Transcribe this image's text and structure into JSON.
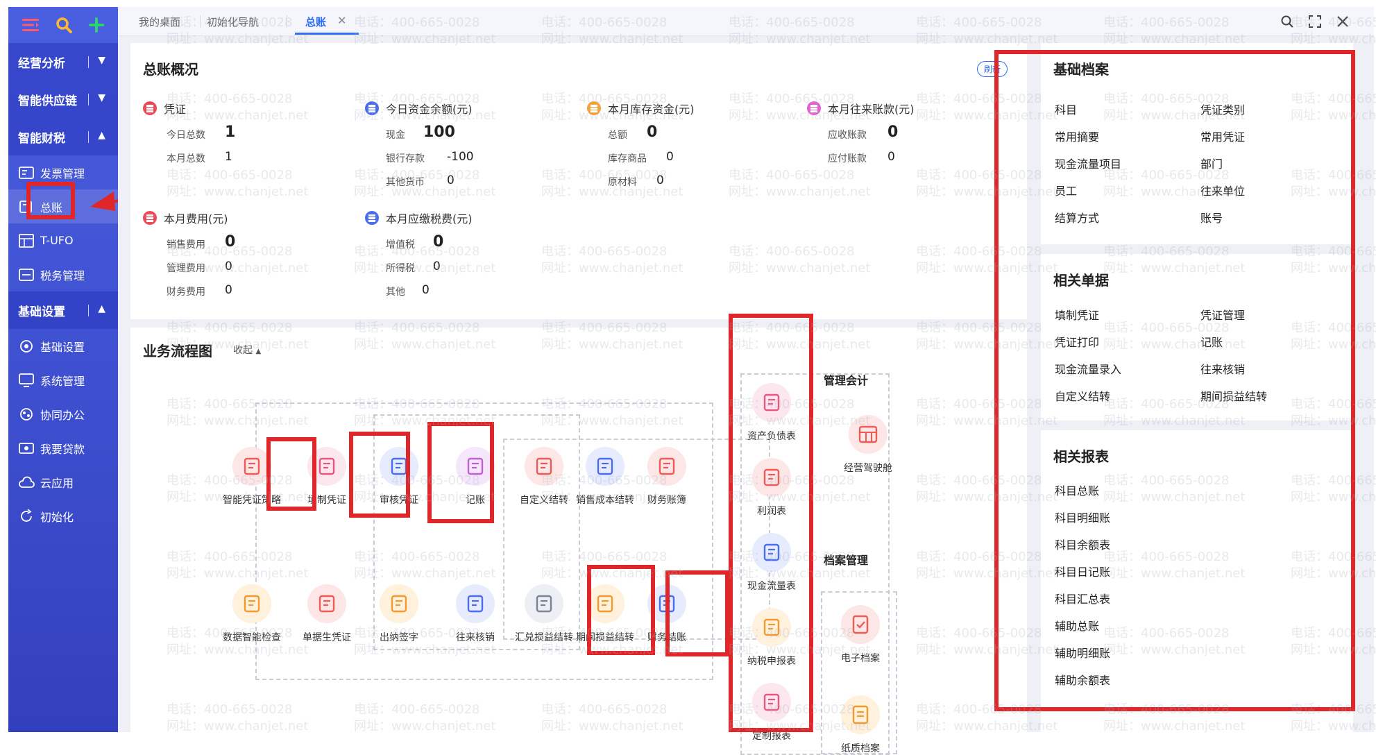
{
  "sidebar": {
    "groups": [
      {
        "label": "经营分析"
      },
      {
        "label": "智能供应链"
      },
      {
        "label": "智能财税"
      },
      {
        "label": "基础设置"
      }
    ],
    "tax_items": [
      "发票管理",
      "总账",
      "T-UFO",
      "税务管理"
    ],
    "setting_items": [
      "基础设置",
      "系统管理",
      "协同办公",
      "我要贷款",
      "云应用",
      "初始化"
    ]
  },
  "tabs": [
    "我的桌面",
    "初始化导航",
    "总账"
  ],
  "overview": {
    "title": "总账概况",
    "refresh_label": "刷新",
    "voucher": {
      "title": "凭证",
      "rows": [
        {
          "label": "今日总数",
          "value": "1"
        },
        {
          "label": "本月总数",
          "value": "1"
        }
      ]
    },
    "cash": {
      "title": "今日资金余额(元)",
      "rows": [
        {
          "label": "现金",
          "value": "100"
        },
        {
          "label": "银行存款",
          "value": "-100"
        },
        {
          "label": "其他货币",
          "value": "0"
        }
      ]
    },
    "inventory": {
      "title": "本月库存资金(元)",
      "rows": [
        {
          "label": "总额",
          "value": "0"
        },
        {
          "label": "库存商品",
          "value": "0"
        },
        {
          "label": "原材料",
          "value": "0"
        }
      ]
    },
    "current": {
      "title": "本月往来账款(元)",
      "rows": [
        {
          "label": "应收账款",
          "value": "0"
        },
        {
          "label": "应付账款",
          "value": "0"
        }
      ]
    },
    "expense": {
      "title": "本月费用(元)",
      "rows": [
        {
          "label": "销售费用",
          "value": "0"
        },
        {
          "label": "管理费用",
          "value": "0"
        },
        {
          "label": "财务费用",
          "value": "0"
        }
      ]
    },
    "tax": {
      "title": "本月应缴税费(元)",
      "rows": [
        {
          "label": "增值税",
          "value": "0"
        },
        {
          "label": "所得税",
          "value": "0"
        },
        {
          "label": "其他",
          "value": "0"
        }
      ]
    }
  },
  "flow": {
    "title": "业务流程图",
    "collapse_label": "收起",
    "row1": [
      "智能凭证策略",
      "填制凭证",
      "审核凭证",
      "记账",
      "自定义结转",
      "销售成本结转",
      "财务账簿"
    ],
    "row2": [
      "数据智能检查",
      "单据生凭证",
      "出纳签字",
      "往来核销",
      "汇兑损益结转",
      "期间损益结转",
      "财务结账"
    ],
    "reports": [
      "资产负债表",
      "利润表",
      "现金流量表",
      "纳税申报表",
      "定制报表"
    ],
    "mgmt_title": "管理会计",
    "mgmt_item": "经营驾驶舱",
    "archive_title": "档案管理",
    "archive_items": [
      "电子档案",
      "纸质档案"
    ]
  },
  "right_panel": {
    "basic": {
      "title": "基础档案",
      "left": [
        "科目",
        "常用摘要",
        "现金流量项目",
        "员工",
        "结算方式"
      ],
      "right": [
        "凭证类别",
        "常用凭证",
        "部门",
        "往来单位",
        "账号"
      ]
    },
    "docs": {
      "title": "相关单据",
      "left": [
        "填制凭证",
        "凭证打印",
        "现金流量录入",
        "自定义结转"
      ],
      "right": [
        "凭证管理",
        "记账",
        "往来核销",
        "期间损益结转"
      ]
    },
    "reports": {
      "title": "相关报表",
      "items": [
        "科目总账",
        "科目明细账",
        "科目余额表",
        "科目日记账",
        "科目汇总表",
        "辅助总账",
        "辅助明细账",
        "辅助余额表"
      ]
    }
  },
  "watermark": {
    "phone": "电话：400-665-0028",
    "site": "网址：www.chanjet.net"
  },
  "colors": {
    "sidebar": "#3d4fcf",
    "accent": "#2f6df6",
    "highlight": "#e02628"
  }
}
